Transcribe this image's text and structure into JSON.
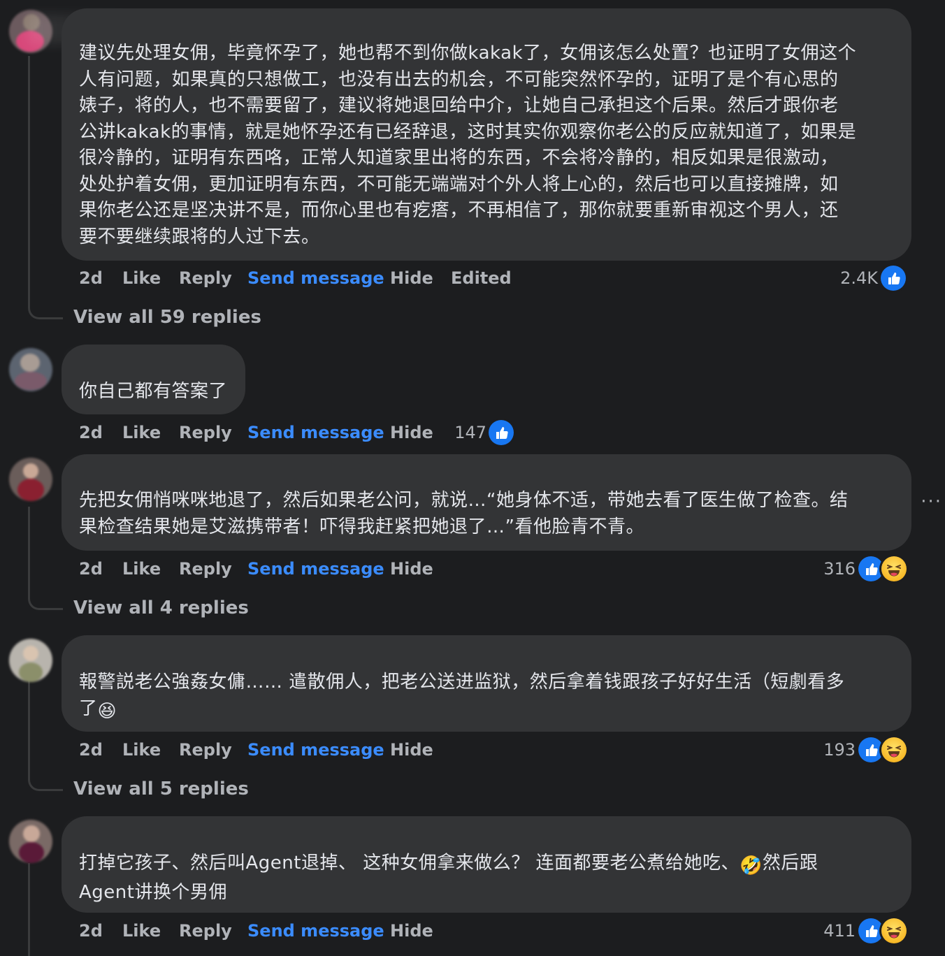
{
  "comments": [
    {
      "text": "建议先处理女佣，毕竟怀孕了，她也帮不到你做kakak了，女佣该怎么处置？也证明了女佣这个\n人有问题，如果真的只想做工，也没有出去的机会，不可能突然怀孕的，证明了是个有心思的\n婊子，将的人，也不需要留了，建议将她退回给中介，让她自己承担这个后果。然后才跟你老\n公讲kakak的事情，就是她怀孕还有已经辞退，这时其实你观察你老公的反应就知道了，如果是\n很冷静的，证明有东西咯，正常人知道家里出将的东西，不会将冷静的，相反如果是很激动，\n处处护着女佣，更加证明有东西，不可能无端端对个外人将上心的，然后也可以直接摊牌，如\n果你老公还是坚决讲不是，而你心里也有疙瘩，不再相信了，那你就要重新审视这个男人，还\n要不要继续跟将的人过下去。",
      "time": "2d",
      "like": "Like",
      "reply": "Reply",
      "send_message": "Send message",
      "hide": "Hide",
      "edited": "Edited",
      "reaction_count": "2.4K",
      "reactions": [
        "like-icon"
      ],
      "view_replies": "View all 59 replies"
    },
    {
      "text": "你自己都有答案了",
      "time": "2d",
      "like": "Like",
      "reply": "Reply",
      "send_message": "Send message",
      "hide": "Hide",
      "reaction_count": "147",
      "reactions": [
        "like-icon"
      ]
    },
    {
      "text": "先把女佣悄咪咪地退了，然后如果老公问，就说…“她身体不适，带她去看了医生做了检查。结\n果检查结果她是艾滋携带者！吓得我赶紧把她退了…”看他脸青不青。",
      "time": "2d",
      "like": "Like",
      "reply": "Reply",
      "send_message": "Send message",
      "hide": "Hide",
      "reaction_count": "316",
      "reactions": [
        "like-icon",
        "haha-icon"
      ],
      "view_replies": "View all 4 replies"
    },
    {
      "text_line1": "報警説老公強姦女傭…… 遣散佣人，把老公送进监狱，然后拿着钱跟孩子好好生活（短劇看多",
      "text_line2": "了",
      "emoji": "😆",
      "time": "2d",
      "like": "Like",
      "reply": "Reply",
      "send_message": "Send message",
      "hide": "Hide",
      "reaction_count": "193",
      "reactions": [
        "like-icon",
        "haha-icon"
      ],
      "view_replies": "View all 5 replies"
    },
    {
      "text_line1_a": "打掉它孩子、然后叫Agent退掉、 这种女佣拿来做么？ 连面都要老公煮给她吃、",
      "emoji": "🤣",
      "text_line1_b": "然后跟",
      "text_line2": "Agent讲换个男佣",
      "time": "2d",
      "like": "Like",
      "reply": "Reply",
      "send_message": "Send message",
      "hide": "Hide",
      "reaction_count": "411",
      "reactions": [
        "like-icon",
        "haha-icon"
      ]
    }
  ],
  "more_options": "···"
}
